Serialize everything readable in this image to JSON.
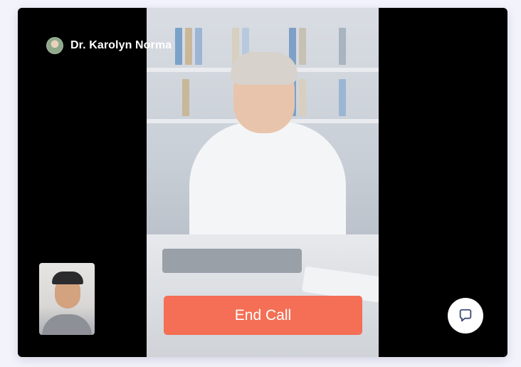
{
  "call": {
    "caller_name": "Dr. Karolyn Norma",
    "end_call_label": "End Call"
  },
  "icons": {
    "chat": "chat-bubble-icon"
  },
  "colors": {
    "accent_end_call": "#f46f55",
    "card_background": "#000000",
    "chat_icon": "#3c4b78"
  }
}
